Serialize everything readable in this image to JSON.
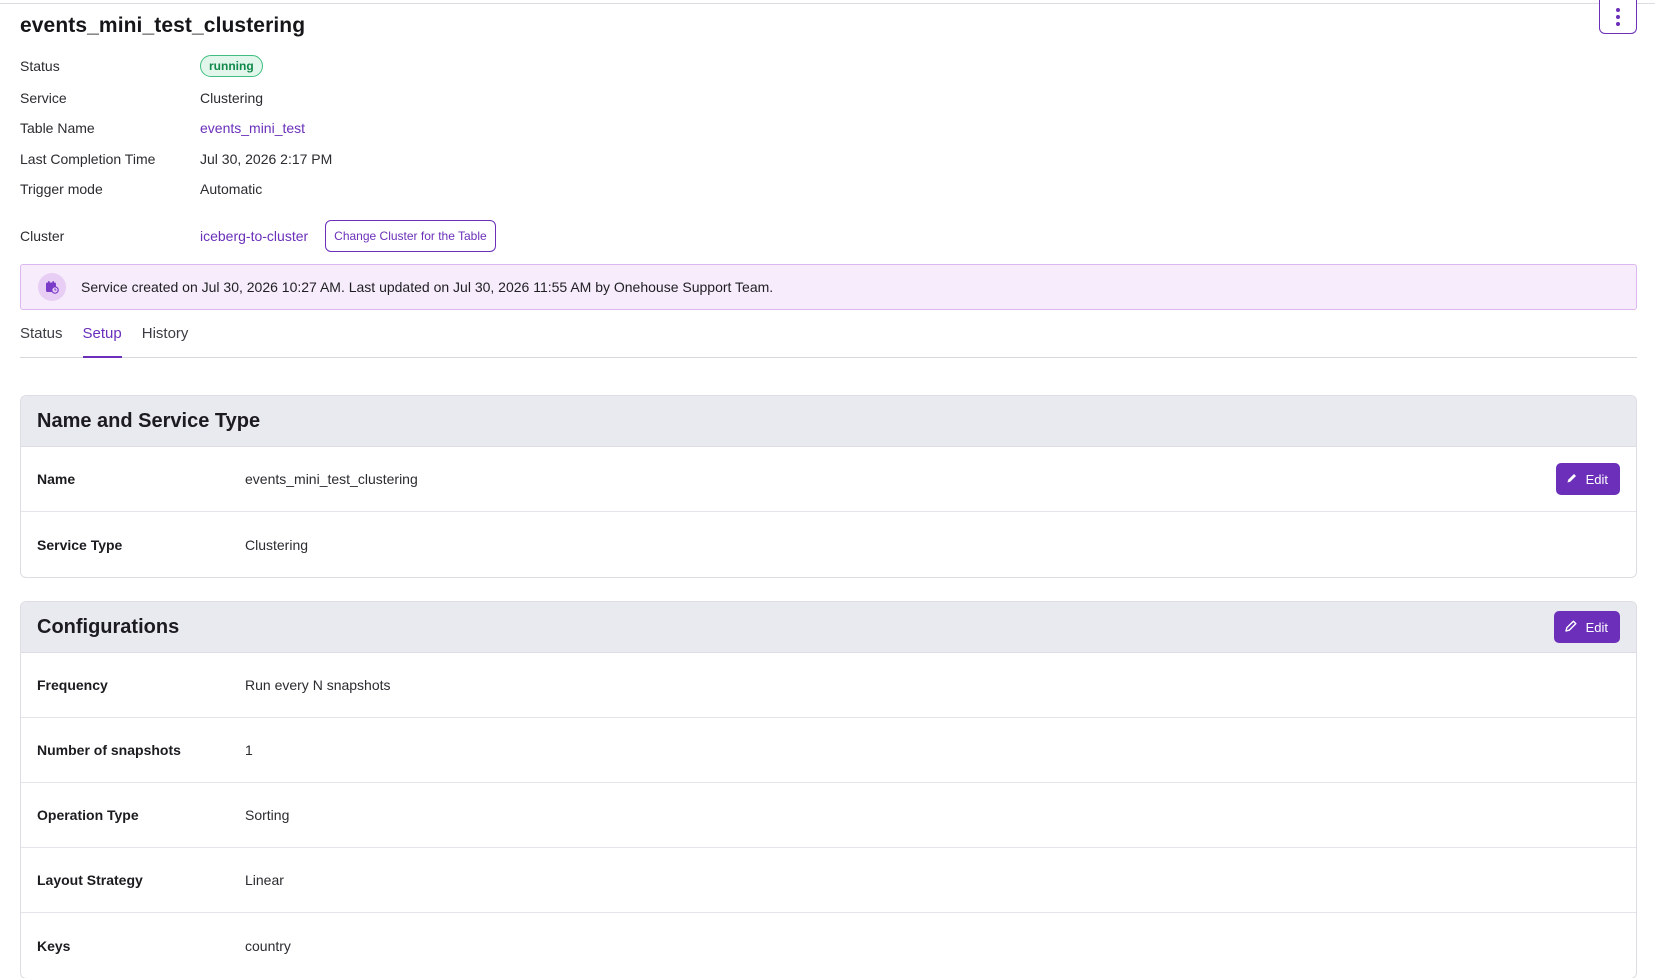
{
  "page": {
    "title": "events_mini_test_clustering"
  },
  "details": {
    "status_label": "Status",
    "status_value": "running",
    "service_label": "Service",
    "service_value": "Clustering",
    "table_name_label": "Table Name",
    "table_name_value": "events_mini_test",
    "last_completion_label": "Last Completion Time",
    "last_completion_value": "Jul 30, 2026 2:17 PM",
    "trigger_mode_label": "Trigger mode",
    "trigger_mode_value": "Automatic",
    "cluster_label": "Cluster",
    "cluster_value": "iceberg-to-cluster",
    "change_cluster_button": "Change Cluster for the Table"
  },
  "banner": {
    "text": "Service created on Jul 30, 2026 10:27 AM. Last updated on Jul 30, 2026 11:55 AM by Onehouse Support Team."
  },
  "tabs": [
    {
      "label": "Status",
      "active": false
    },
    {
      "label": "Setup",
      "active": true
    },
    {
      "label": "History",
      "active": false
    }
  ],
  "name_card": {
    "title": "Name and Service Type",
    "edit_label": "Edit",
    "rows": [
      {
        "label": "Name",
        "value": "events_mini_test_clustering"
      },
      {
        "label": "Service Type",
        "value": "Clustering"
      }
    ]
  },
  "config_card": {
    "title": "Configurations",
    "edit_label": "Edit",
    "rows": [
      {
        "label": "Frequency",
        "value": "Run every N snapshots"
      },
      {
        "label": "Number of snapshots",
        "value": "1"
      },
      {
        "label": "Operation Type",
        "value": "Sorting"
      },
      {
        "label": "Layout Strategy",
        "value": "Linear"
      },
      {
        "label": "Keys",
        "value": "country"
      }
    ]
  },
  "colors": {
    "accent": "#6b2fba",
    "status_green": "#128a4b",
    "banner_bg": "#f7ecfb",
    "card_header_bg": "#e9e9f0"
  },
  "icons": {
    "menu": "kebab-icon",
    "banner": "calendar-clock-icon",
    "edit": "pencil-icon"
  }
}
